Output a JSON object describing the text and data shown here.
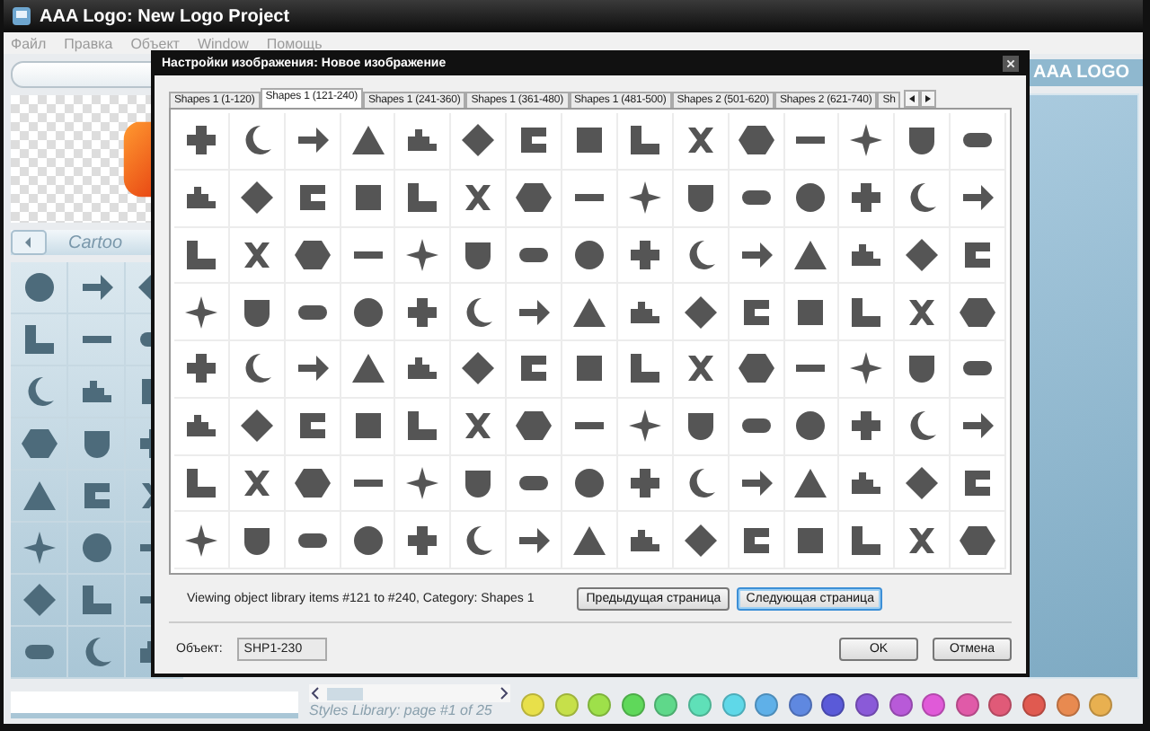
{
  "window": {
    "title": "AAA Logo: New Logo Project"
  },
  "menu": [
    "Файл",
    "Правка",
    "Объект",
    "Window",
    "Помощь"
  ],
  "left_panel": {
    "library_title": "Cartoo"
  },
  "right_panel": {
    "title": "AAA LOGO"
  },
  "dialog": {
    "title": "Настройки изображения: Новое изображение",
    "tabs": [
      {
        "label": "Shapes 1 (1-120)",
        "selected": false
      },
      {
        "label": "Shapes 1 (121-240)",
        "selected": true
      },
      {
        "label": "Shapes 1 (241-360)",
        "selected": false
      },
      {
        "label": "Shapes 1 (361-480)",
        "selected": false
      },
      {
        "label": "Shapes 1 (481-500)",
        "selected": false
      },
      {
        "label": "Shapes 2 (501-620)",
        "selected": false
      },
      {
        "label": "Shapes 2 (621-740)",
        "selected": false
      },
      {
        "label": "Sh",
        "selected": false
      }
    ],
    "status": "Viewing object library items #121 to #240, Category: Shapes 1",
    "page_buttons": [
      {
        "label": "Предыдущая страница",
        "focused": false
      },
      {
        "label": "Следующая страница",
        "focused": true
      }
    ],
    "object_label": "Объект:",
    "object_value": "SHP1-230",
    "ok": "OK",
    "cancel": "Отмена"
  },
  "styles_library": {
    "caption": "Styles Library: page #1 of 25",
    "swatches": [
      {
        "color": "#e8e04a"
      },
      {
        "color": "#c6e04a"
      },
      {
        "color": "#9ee04a"
      },
      {
        "color": "#5fd85a"
      },
      {
        "color": "#5fd88a"
      },
      {
        "color": "#5fe0b8"
      },
      {
        "color": "#5fd8e8"
      },
      {
        "color": "#5fb0e8"
      },
      {
        "color": "#5f88e0"
      },
      {
        "color": "#5a5ad8"
      },
      {
        "color": "#8a5ad8"
      },
      {
        "color": "#b85ad8"
      },
      {
        "color": "#e05ad8"
      },
      {
        "color": "#e05aa8"
      },
      {
        "color": "#e05a78"
      },
      {
        "color": "#e05a50"
      },
      {
        "color": "#e88a50"
      },
      {
        "color": "#e8b050"
      }
    ]
  }
}
